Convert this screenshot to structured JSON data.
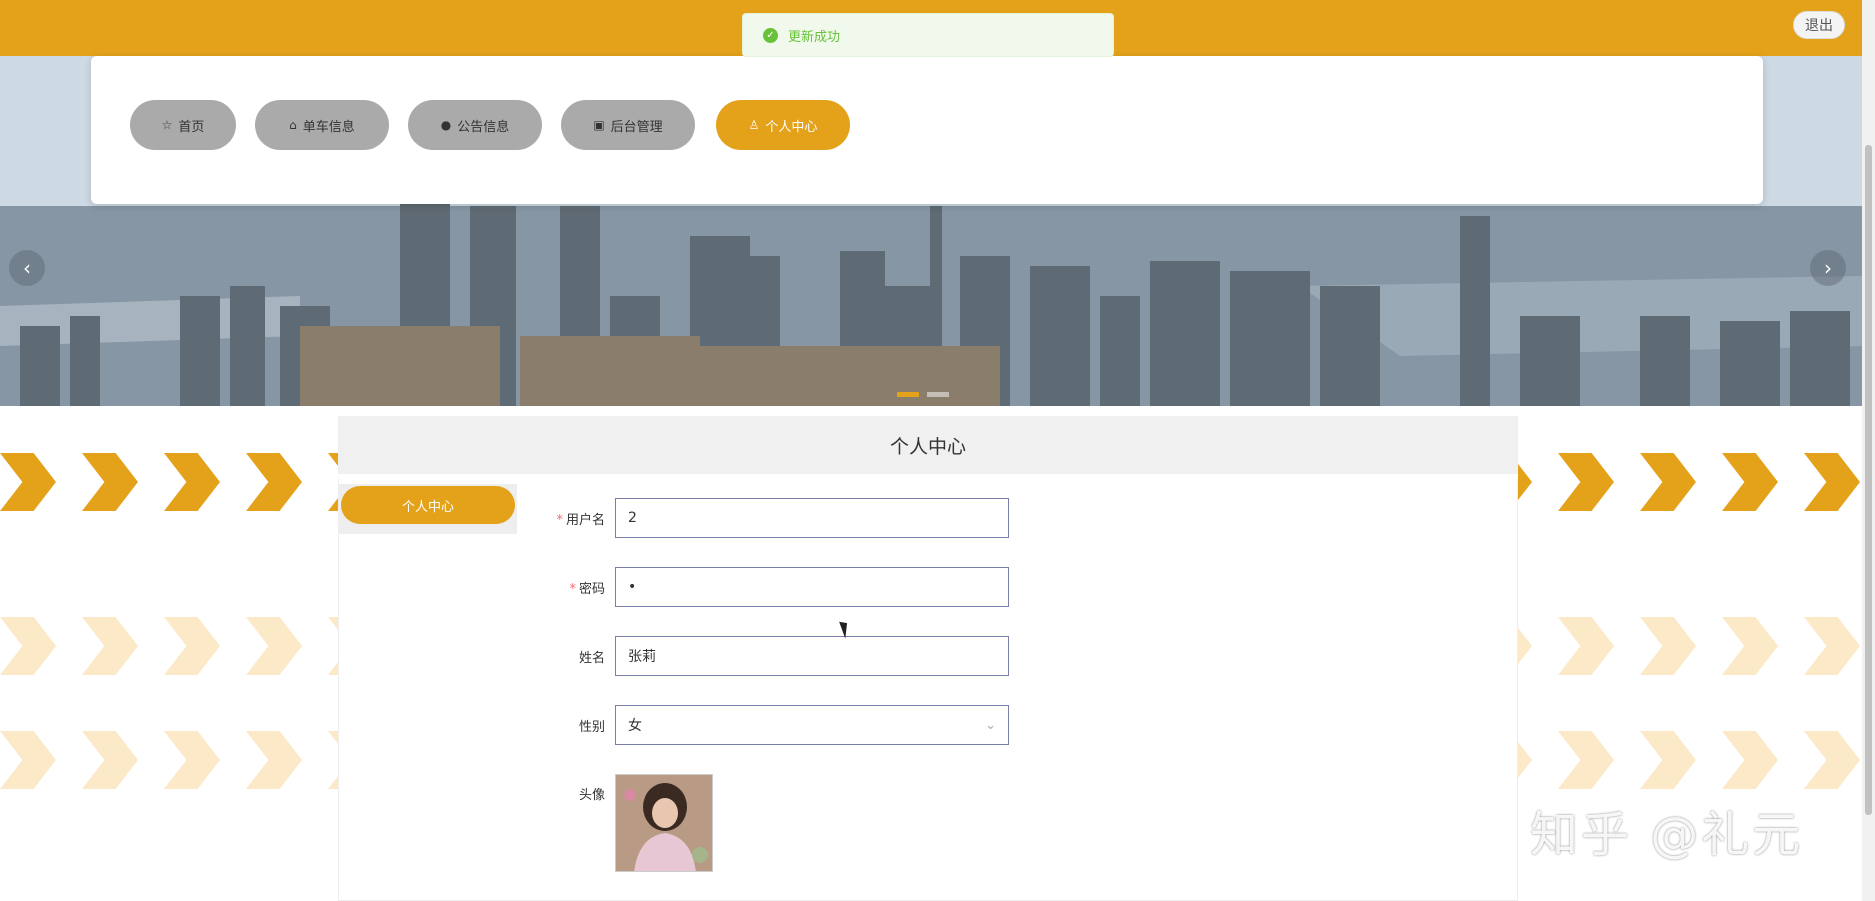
{
  "header": {
    "logout_label": "退出",
    "accent_color": "#e3a21a"
  },
  "toast": {
    "message": "更新成功",
    "icon": "check-circle-icon",
    "color": "#67c23a"
  },
  "nav": {
    "items": [
      {
        "label": "首页",
        "icon": "star-icon"
      },
      {
        "label": "单车信息",
        "icon": "bag-icon"
      },
      {
        "label": "公告信息",
        "icon": "info-icon"
      },
      {
        "label": "后台管理",
        "icon": "box-icon"
      },
      {
        "label": "个人中心",
        "icon": "user-icon",
        "active": true
      }
    ]
  },
  "carousel": {
    "prev_icon": "chevron-left-icon",
    "next_icon": "chevron-right-icon",
    "prev_label": "‹",
    "next_label": "›"
  },
  "panel": {
    "title": "个人中心",
    "side_menu": [
      "个人中心"
    ]
  },
  "form": {
    "username": {
      "label": "用户名",
      "required": true,
      "value": "2"
    },
    "password": {
      "label": "密码",
      "required": true,
      "value": "•"
    },
    "name": {
      "label": "姓名",
      "value": "张莉"
    },
    "gender": {
      "label": "性别",
      "value": "女"
    },
    "avatar": {
      "label": "头像"
    }
  },
  "watermark": "知乎 @礼元"
}
